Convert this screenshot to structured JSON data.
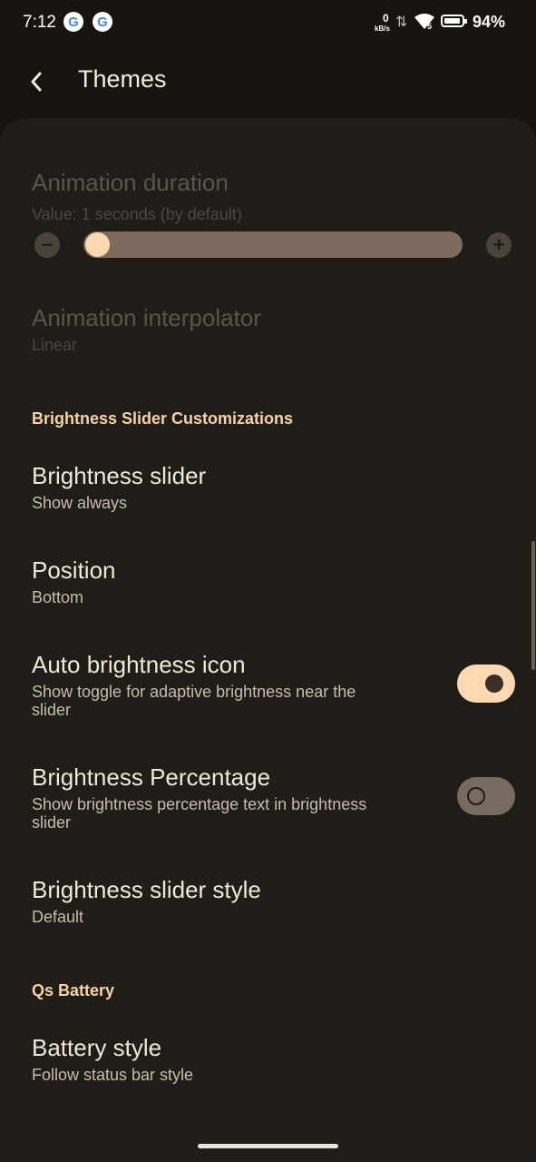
{
  "status": {
    "time": "7:12",
    "google_icon_letter": "G",
    "net_speed_value": "0",
    "net_speed_unit": "kB/s",
    "signal_label": "5",
    "battery_pct": "94%"
  },
  "header": {
    "title": "Themes"
  },
  "animation_duration": {
    "title": "Animation duration",
    "subtitle": "Value: 1 seconds (by default)",
    "minus": "−",
    "plus": "+",
    "slider_fraction": 0.0
  },
  "animation_interpolator": {
    "title": "Animation interpolator",
    "subtitle": "Linear"
  },
  "sections": {
    "brightness": "Brightness Slider Customizations",
    "qs_battery": "Qs Battery"
  },
  "brightness_slider": {
    "title": "Brightness slider",
    "subtitle": "Show always"
  },
  "position": {
    "title": "Position",
    "subtitle": "Bottom"
  },
  "auto_brightness_icon": {
    "title": "Auto brightness icon",
    "subtitle_line1": "Show toggle for adaptive brightness near the",
    "subtitle_line2": "slider",
    "enabled": true
  },
  "brightness_percentage": {
    "title": "Brightness Percentage",
    "subtitle_line1": "Show brightness percentage text in brightness",
    "subtitle_line2": "slider",
    "enabled": false
  },
  "brightness_slider_style": {
    "title": "Brightness slider style",
    "subtitle": "Default"
  },
  "battery_style": {
    "title": "Battery style",
    "subtitle": "Follow status bar style"
  },
  "colors": {
    "accent": "#ffd9b1",
    "section": "#f6d3a4",
    "card": "#201c18",
    "background": "#17140f"
  }
}
